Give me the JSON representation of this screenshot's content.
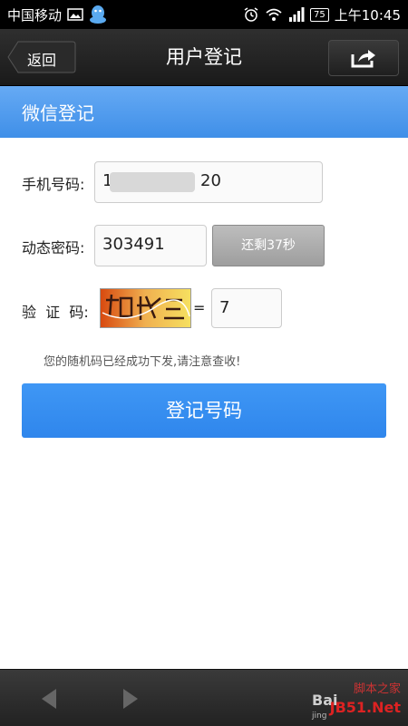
{
  "status_bar": {
    "carrier": "中国移动",
    "battery": "75",
    "time": "上午10:45",
    "icons": [
      "image-icon",
      "qq-icon",
      "alarm-icon",
      "wifi-icon",
      "signal-icon",
      "battery-icon"
    ]
  },
  "nav": {
    "back_label": "返回",
    "title": "用户登记",
    "share_icon": "share-icon"
  },
  "section": {
    "title": "微信登记"
  },
  "form": {
    "phone_label": "手机号码:",
    "phone_prefix": "1",
    "phone_suffix": "20",
    "otp_label": "动态密码:",
    "otp_value": "303491",
    "countdown_label": "还剩37秒",
    "captcha_label": "验  证  码:",
    "captcha_equals": "=",
    "captcha_value": "7",
    "notice": "您的随机码已经成功下发,请注意查收!"
  },
  "submit_label": "登记号码",
  "bottom_bar": {
    "icons": [
      "back-arrow-icon",
      "forward-arrow-icon"
    ],
    "watermark_top": "脚本之家",
    "watermark_bottom": "JB51.Net",
    "watermark_left": "Bai",
    "watermark_small": "jing"
  },
  "colors": {
    "header_blue": "#4a98ee",
    "button_blue": "#3a8ff0",
    "countdown_gray": "#a8a8a8"
  }
}
